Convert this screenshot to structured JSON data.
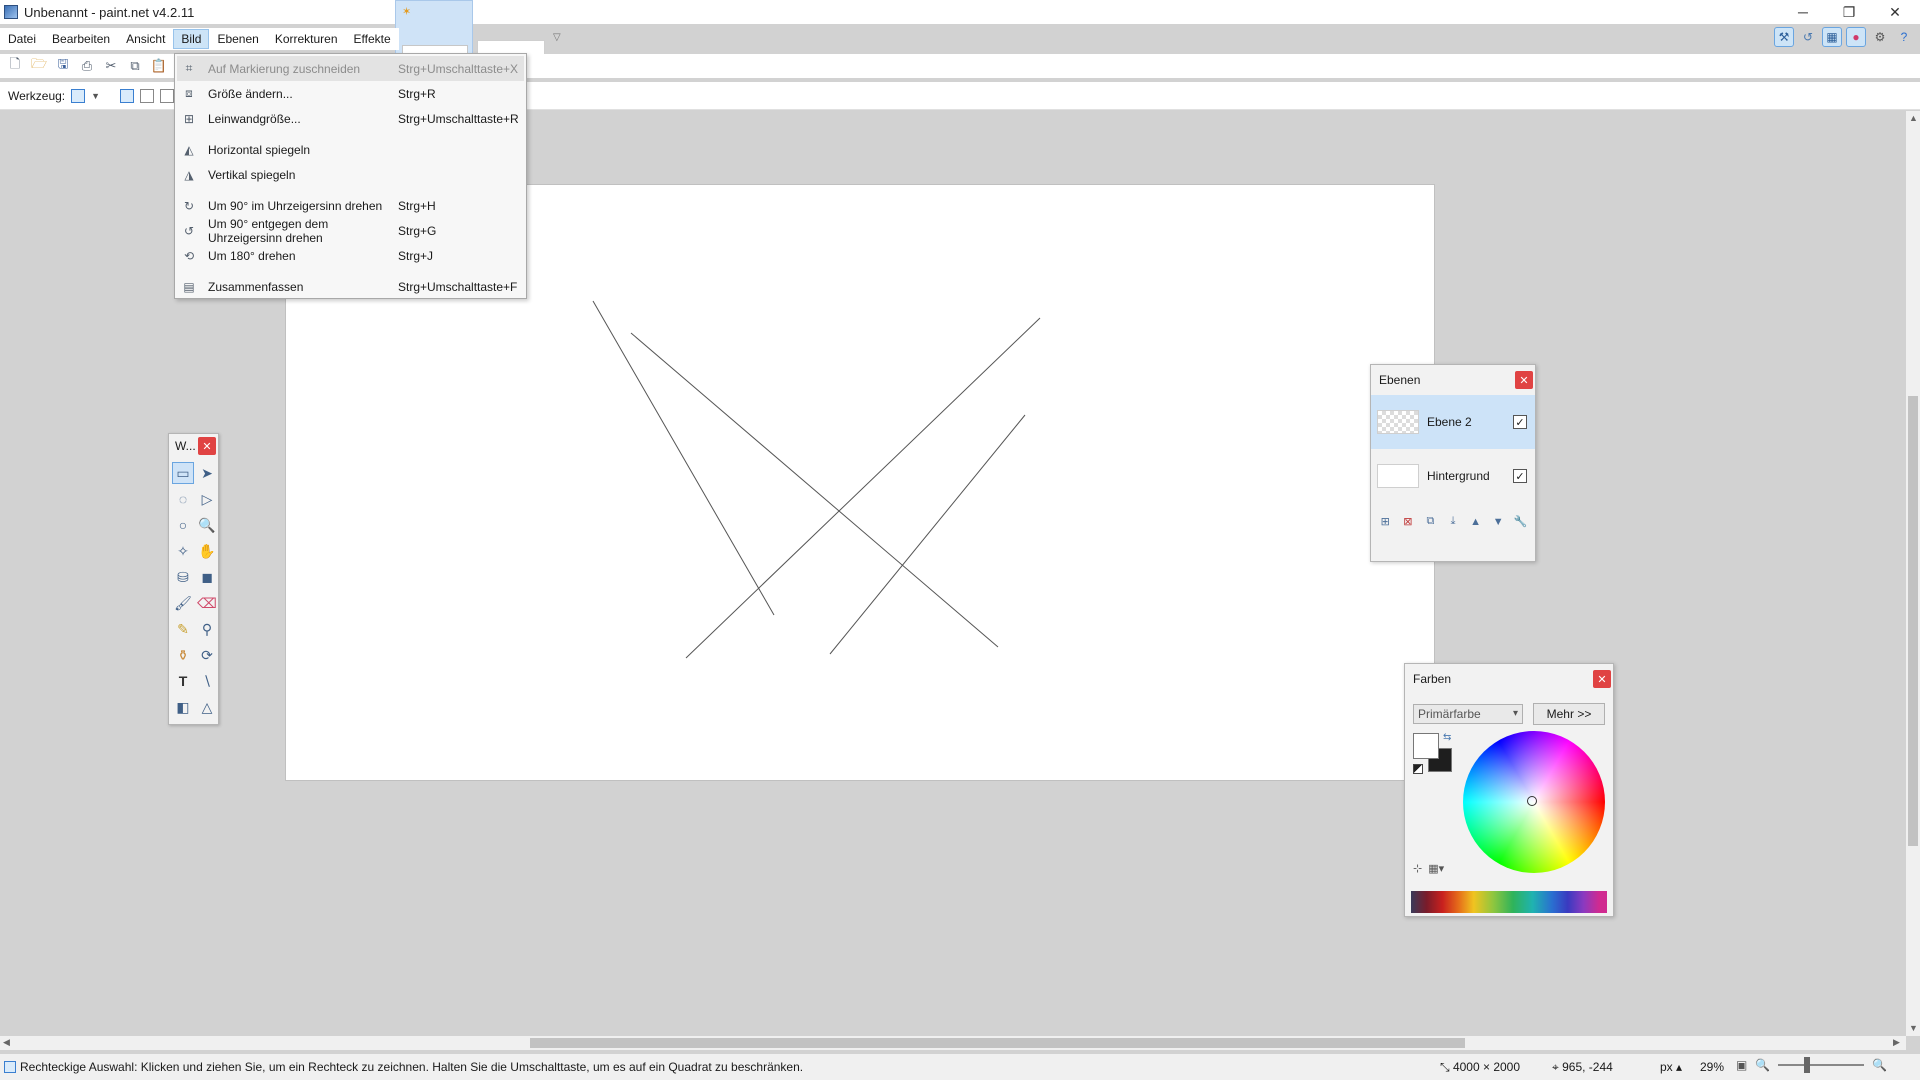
{
  "window": {
    "title": "Unbenannt - paint.net v4.2.11",
    "min_glyph": "─",
    "max_glyph": "❐",
    "close_glyph": "✕"
  },
  "menubar": {
    "items": [
      {
        "label": "Datei"
      },
      {
        "label": "Bearbeiten"
      },
      {
        "label": "Ansicht"
      },
      {
        "label": "Bild"
      },
      {
        "label": "Ebenen"
      },
      {
        "label": "Korrekturen"
      },
      {
        "label": "Effekte"
      }
    ],
    "active": "Bild"
  },
  "toolbar": {
    "tool_label": "Werkzeug:"
  },
  "image_menu": {
    "items": [
      {
        "label": "Auf Markierung zuschneiden",
        "shortcut": "Strg+Umschalttaste+X",
        "disabled": true,
        "icon": "crop-icon"
      },
      {
        "label": "Größe ändern...",
        "shortcut": "Strg+R",
        "disabled": false,
        "icon": "resize-icon"
      },
      {
        "label": "Leinwandgröße...",
        "shortcut": "Strg+Umschalttaste+R",
        "disabled": false,
        "icon": "canvas-size-icon"
      },
      {
        "label": "Horizontal spiegeln",
        "shortcut": "",
        "disabled": false,
        "icon": "flip-horizontal-icon"
      },
      {
        "label": "Vertikal spiegeln",
        "shortcut": "",
        "disabled": false,
        "icon": "flip-vertical-icon"
      },
      {
        "label": "Um 90° im Uhrzeigersinn drehen",
        "shortcut": "Strg+H",
        "disabled": false,
        "icon": "rotate-cw-icon"
      },
      {
        "label": "Um 90° entgegen dem Uhrzeigersinn drehen",
        "shortcut": "Strg+G",
        "disabled": false,
        "icon": "rotate-ccw-icon"
      },
      {
        "label": "Um 180° drehen",
        "shortcut": "Strg+J",
        "disabled": false,
        "icon": "rotate-180-icon"
      },
      {
        "label": "Zusammenfassen",
        "shortcut": "Strg+Umschalttaste+F",
        "disabled": false,
        "icon": "flatten-icon"
      }
    ]
  },
  "tools_window": {
    "title": "W..."
  },
  "layers_window": {
    "title": "Ebenen",
    "layers": [
      {
        "name": "Ebene 2",
        "visible": true,
        "selected": true
      },
      {
        "name": "Hintergrund",
        "visible": true,
        "selected": false
      }
    ]
  },
  "colors_window": {
    "title": "Farben",
    "mode": "Primärfarbe",
    "more_label": "Mehr >>",
    "primary_color": "#ffffff",
    "secondary_color": "#1e1e1e"
  },
  "status": {
    "text": "Rechteckige Auswahl: Klicken und ziehen Sie, um ein Rechteck zu zeichnen. Halten Sie die Umschalttaste, um es auf ein Quadrat zu beschränken.",
    "image_size": "4000 × 2000",
    "cursor_pos": "965, -244",
    "unit": "px",
    "zoom": "29%"
  },
  "colors": {
    "accent": "#cde4f7",
    "close_red": "#e04343"
  }
}
